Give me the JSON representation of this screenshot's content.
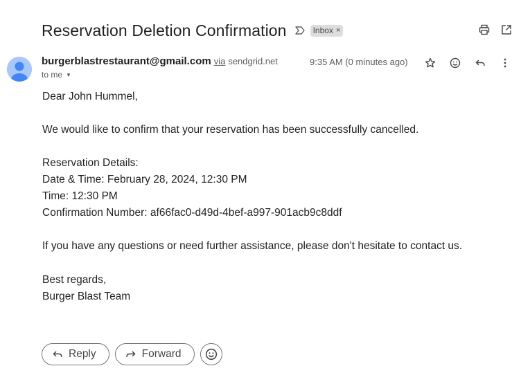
{
  "email": {
    "subject": "Reservation Deletion Confirmation",
    "label": "Inbox",
    "label_remove": "×",
    "sender_email": "burgerblastrestaurant@gmail.com",
    "via_label": "via",
    "via_domain": "sendgrid.net",
    "to_label": "to me",
    "time": "9:35 AM (0 minutes ago)",
    "body": {
      "greeting": "Dear John Hummel,",
      "intro": "We would like to confirm that your reservation has been successfully cancelled.",
      "details_heading": "Reservation Details:",
      "date_time": "Date & Time: February 28, 2024, 12:30 PM",
      "time_line": "Time: 12:30 PM",
      "confirmation": "Confirmation Number: af66fac0-d49d-4bef-a997-901acb9c8ddf",
      "questions": "If you have any questions or need further assistance, please don't hesitate to contact us.",
      "closing": "Best regards,",
      "signature": "Burger Blast Team"
    }
  },
  "actions": {
    "reply_label": "Reply",
    "forward_label": "Forward"
  },
  "icons": {
    "important": "important-marker-icon",
    "print": "print-icon",
    "new_window": "open-in-new-window-icon",
    "star": "star-icon",
    "emoji": "emoji-reaction-icon",
    "reply": "reply-icon",
    "more": "more-vert-icon",
    "forward": "forward-icon",
    "avatar": "default-avatar-icon"
  },
  "colors": {
    "avatar_bg": "#a8c7fa",
    "avatar_fg": "#4285f4",
    "label_chip_bg": "#dddddd"
  }
}
